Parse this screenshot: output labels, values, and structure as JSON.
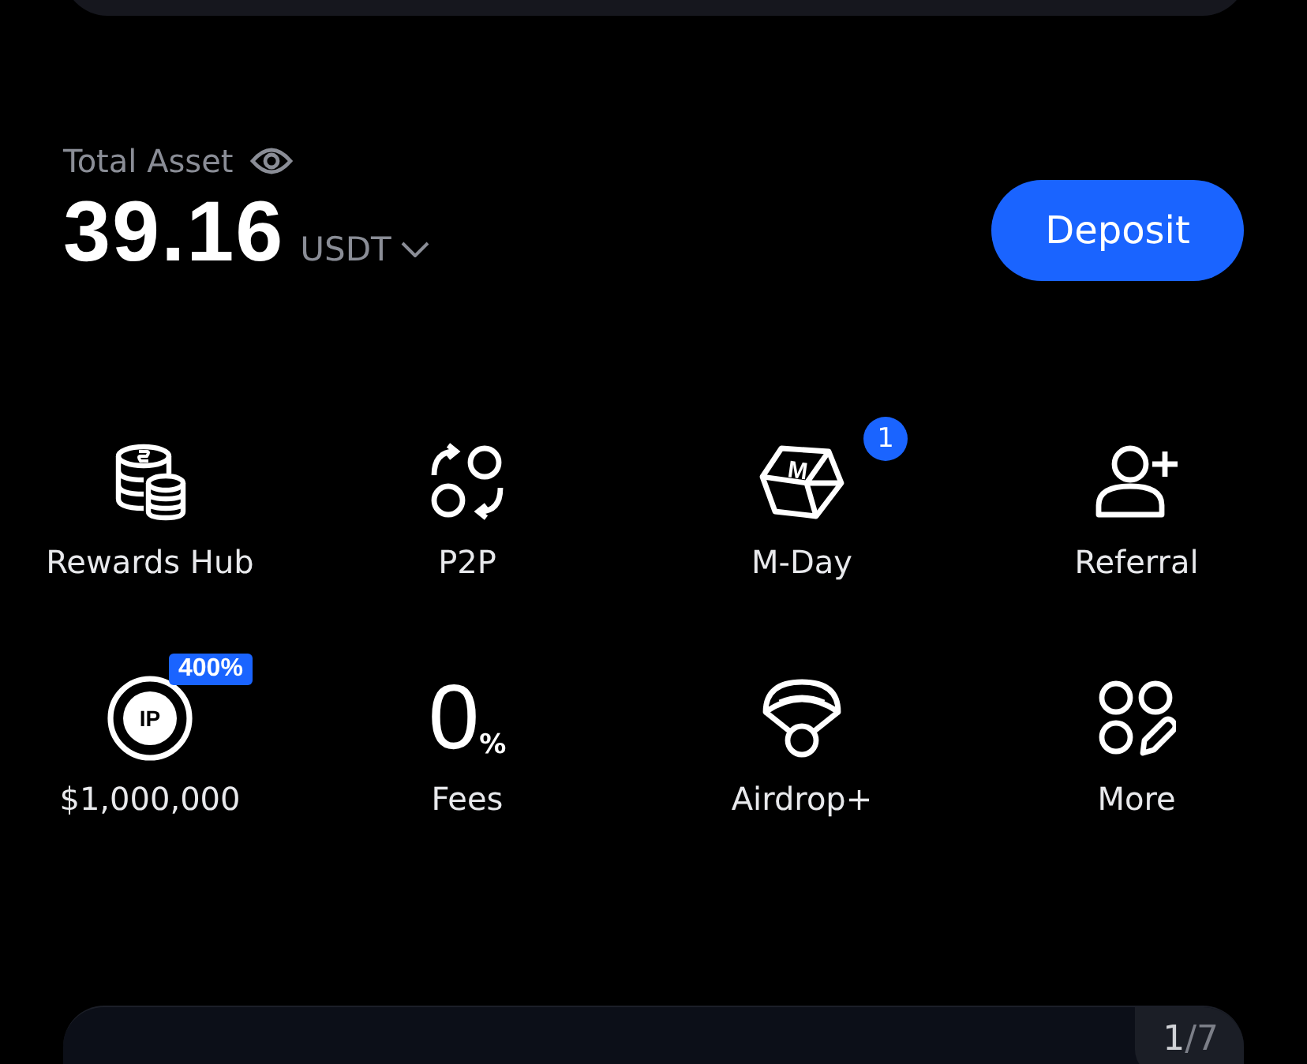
{
  "balance": {
    "label": "Total Asset",
    "amount": "39.16",
    "currency": "USDT"
  },
  "deposit_button": "Deposit",
  "shortcuts": [
    {
      "kind": "coins",
      "label": "Rewards Hub"
    },
    {
      "kind": "swap",
      "label": "P2P"
    },
    {
      "kind": "cube",
      "label": "M-Day",
      "icon_text": "M",
      "badge": "1"
    },
    {
      "kind": "person-add",
      "label": "Referral"
    },
    {
      "kind": "token",
      "label": "$1,000,000",
      "icon_text": "IP",
      "tag": "400%"
    },
    {
      "kind": "zero",
      "label": "Fees",
      "icon_text": "0",
      "icon_suffix": "%"
    },
    {
      "kind": "parachute",
      "label": "Airdrop+"
    },
    {
      "kind": "grid",
      "label": "More"
    }
  ],
  "banner": {
    "current": "1",
    "rest": "/7"
  }
}
